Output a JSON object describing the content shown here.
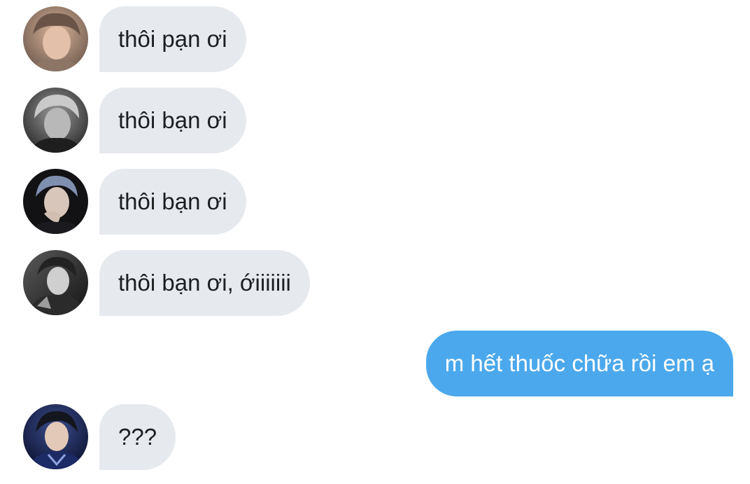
{
  "conversation": {
    "messages": [
      {
        "direction": "incoming",
        "text": "thôi pạn ơi",
        "avatar": "avatar-photo-1"
      },
      {
        "direction": "incoming",
        "text": "thôi bạn ơi",
        "avatar": "avatar-photo-2"
      },
      {
        "direction": "incoming",
        "text": "thôi bạn ơi",
        "avatar": "avatar-photo-3"
      },
      {
        "direction": "incoming",
        "text": "thôi bạn ơi, ớiiiiiii",
        "avatar": "avatar-photo-4"
      },
      {
        "direction": "outgoing",
        "text": "m hết thuốc chữa rồi em ạ"
      },
      {
        "direction": "incoming",
        "text": "???",
        "avatar": "avatar-photo-5"
      }
    ]
  },
  "colors": {
    "incoming_bubble": "#e6e9ee",
    "outgoing_bubble": "#4ba8ec",
    "incoming_text": "#1c1e21",
    "outgoing_text": "#ffffff"
  }
}
